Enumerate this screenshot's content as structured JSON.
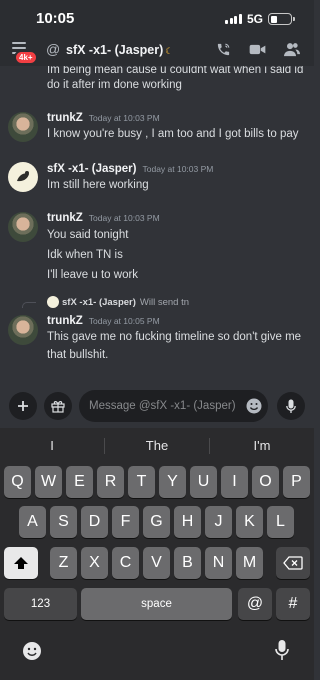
{
  "status_bar": {
    "time": "10:05",
    "network": "5G",
    "battery_percent": 34
  },
  "header": {
    "badge": "4k+",
    "channel_name": "sfX -x1- (Jasper)"
  },
  "messages": [
    {
      "text_lines": [
        "Im being mean cause u couldnt wait when i said id",
        "do it after im done working"
      ]
    },
    {
      "author": "trunkZ",
      "time": "Today at 10:03 PM",
      "text_lines": [
        "I know you're busy , I am too and I got bills to pay"
      ]
    },
    {
      "author": "sfX -x1- (Jasper)",
      "time": "Today at 10:03 PM",
      "text_lines": [
        "Im still here working"
      ]
    },
    {
      "author": "trunkZ",
      "time": "Today at 10:03 PM",
      "text_lines": [
        "You said tonight",
        "Idk when TN is",
        "I'll leave u to work"
      ]
    },
    {
      "reply": {
        "author": "sfX -x1- (Jasper)",
        "text": "Will send tn"
      },
      "author": "trunkZ",
      "time": "Today at 10:05 PM",
      "text_lines": [
        "This gave me no fucking timeline so don't give me",
        "that bullshit."
      ]
    }
  ],
  "composer": {
    "placeholder": "Message @sfX -x1- (Jasper)",
    "value": ""
  },
  "keyboard": {
    "suggestions": [
      "I",
      "The",
      "I'm"
    ],
    "row1": [
      "Q",
      "W",
      "E",
      "R",
      "T",
      "Y",
      "U",
      "I",
      "O",
      "P"
    ],
    "row2": [
      "A",
      "S",
      "D",
      "F",
      "G",
      "H",
      "J",
      "K",
      "L"
    ],
    "row3": [
      "Z",
      "X",
      "C",
      "V",
      "B",
      "N",
      "M"
    ],
    "numbers_label": "123",
    "space_label": "space",
    "at_label": "@",
    "hash_label": "#"
  }
}
